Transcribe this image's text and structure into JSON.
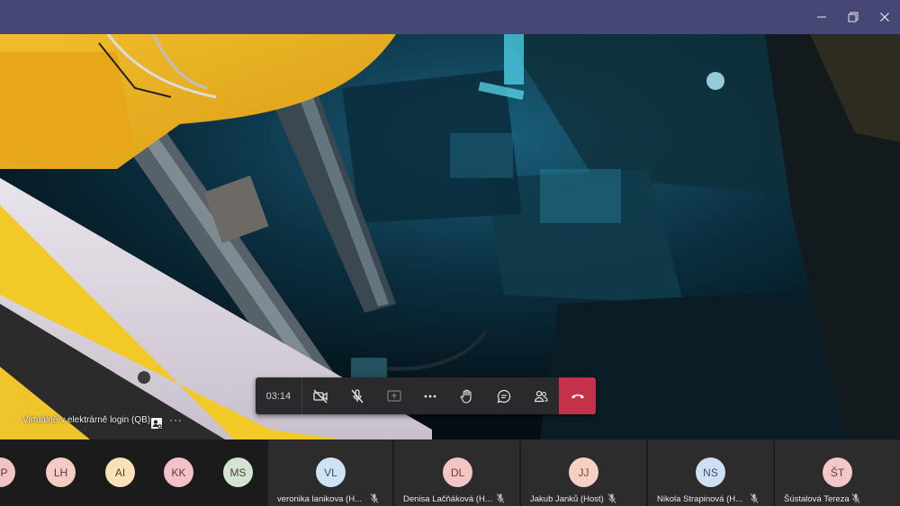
{
  "window": {
    "controls": [
      "minimize-icon",
      "maximize-icon",
      "close-icon"
    ]
  },
  "share": {
    "label": "Virtuálně v elektrárně login (QB)",
    "more": "···"
  },
  "call": {
    "timer": "03:14",
    "hangup_color": "#c4314b"
  },
  "participants_small": [
    {
      "initials": "PP",
      "color": "#f3c2c2"
    },
    {
      "initials": "LH",
      "color": "#f6cbc4"
    },
    {
      "initials": "AI",
      "color": "#fbe1b8"
    },
    {
      "initials": "KK",
      "color": "#f3c2c8"
    },
    {
      "initials": "MS",
      "color": "#d4e4d2"
    }
  ],
  "participants": [
    {
      "initials": "VL",
      "name": "veronika lanikova (H...",
      "color": "#cfe3f3",
      "text": "#33557a"
    },
    {
      "initials": "DL",
      "name": "Denisa Lačňáková (H...",
      "color": "#f3c6c6",
      "text": "#7a3333"
    },
    {
      "initials": "JJ",
      "name": "Jakub Janků (Host)",
      "color": "#f6d0c0",
      "text": "#7a4a33"
    },
    {
      "initials": "NS",
      "name": "Nikola Strapinová (H...",
      "color": "#cfe0f3",
      "text": "#334f7a"
    },
    {
      "initials": "ŠT",
      "name": "Šústalová Tereza",
      "color": "#f3c8c8",
      "text": "#7a3333"
    }
  ]
}
